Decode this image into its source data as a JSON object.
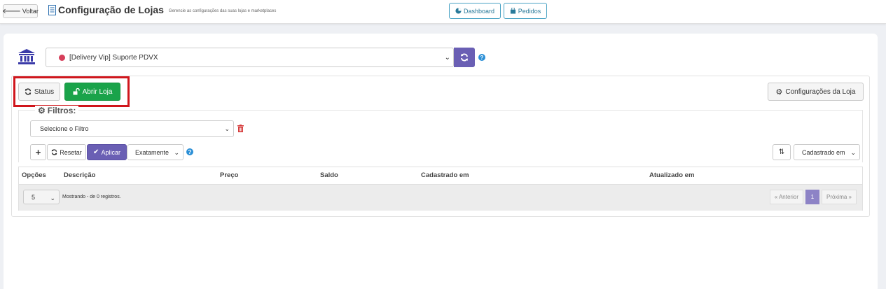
{
  "topbar": {
    "back_label": "Voltar",
    "title": "Configuração de Lojas",
    "subtitle": "Gerencie as configurações das suas lojas e marketplaces",
    "dashboard_label": "Dashboard",
    "orders_label": "Pedidos"
  },
  "store": {
    "selected": "[Delivery Vip] Suporte PDVX",
    "status_color": "#d63f5a",
    "help": "?"
  },
  "actions": {
    "status_label": "Status",
    "open_label": "Abrir Loja",
    "config_label": "Configurações da Loja",
    "highlight_color": "#d0161c"
  },
  "filters": {
    "title": "Filtros:",
    "select_placeholder": "Selecione o Filtro",
    "plus_label": "+",
    "reset_label": "Resetar",
    "apply_label": "Aplicar",
    "match_mode": "Exatamente",
    "help": "?",
    "sort_label": "Cadastrado em"
  },
  "table": {
    "columns": [
      "Opções",
      "Descrição",
      "Preço",
      "Saldo",
      "Cadastrado em",
      "Atualizado em"
    ],
    "per_page": "5",
    "showing_text": "Mostrando - de 0 registros.",
    "pagination": {
      "prev": "« Anterior",
      "current": "1",
      "next": "Próxima »"
    }
  },
  "colors": {
    "accent": "#6a5fb4",
    "success": "#1aa34a",
    "info": "#2b8fd6"
  }
}
